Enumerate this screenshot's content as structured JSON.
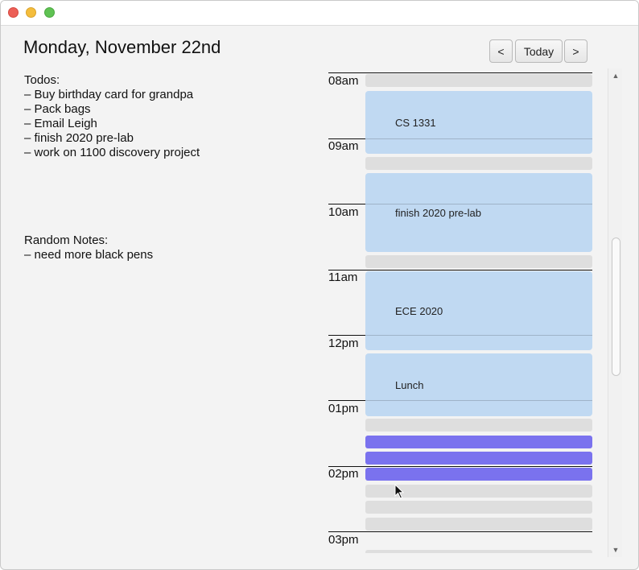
{
  "window": {
    "title": ""
  },
  "header": {
    "date_title": "Monday, November 22nd"
  },
  "nav": {
    "prev_label": "<",
    "today_label": "Today",
    "next_label": ">"
  },
  "todos": {
    "heading": "Todos:",
    "items": [
      "– Buy birthday card for grandpa",
      "– Pack bags",
      "– Email Leigh",
      "– finish 2020 pre-lab",
      "– work on 1100 discovery project"
    ]
  },
  "random_notes": {
    "heading": "Random Notes:",
    "items": [
      "– need more black pens"
    ]
  },
  "calendar": {
    "hours": [
      "08am",
      "09am",
      "10am",
      "11am",
      "12pm",
      "01pm",
      "02pm",
      "03pm"
    ],
    "events": [
      {
        "title": "CS 1331"
      },
      {
        "title": "finish 2020 pre-lab"
      },
      {
        "title": "ECE 2020"
      },
      {
        "title": "Lunch"
      }
    ]
  },
  "colors": {
    "event_fill": "#c0d9f2",
    "slot_fill": "#dedede",
    "highlight_slot": "#7a72ee"
  }
}
